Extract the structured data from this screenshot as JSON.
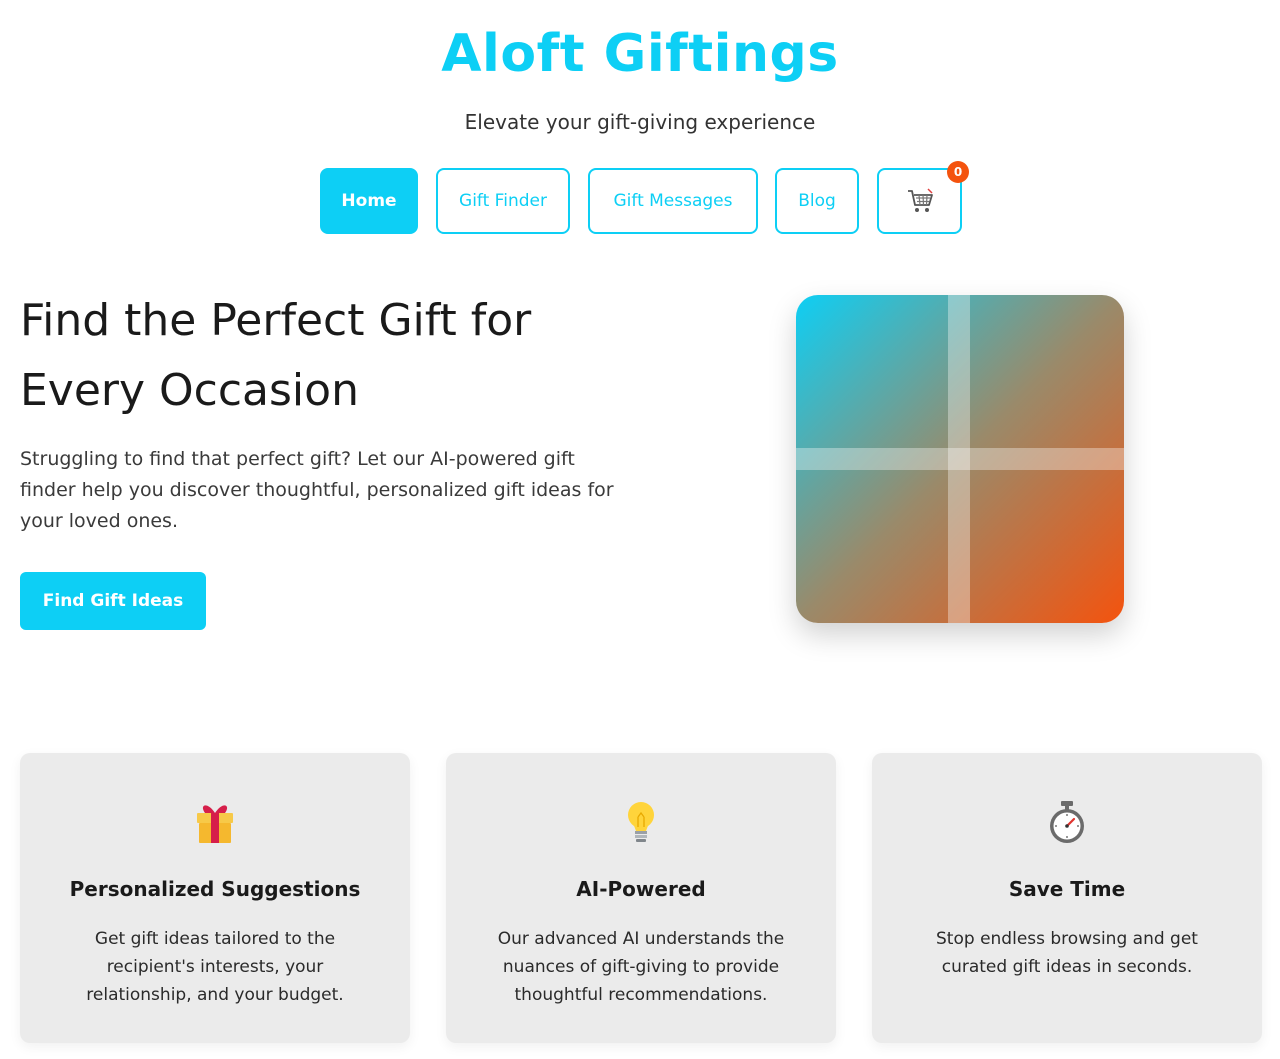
{
  "header": {
    "brand": "Aloft Giftings",
    "tagline": "Elevate your gift-giving experience"
  },
  "nav": {
    "items": [
      {
        "label": "Home",
        "active": true
      },
      {
        "label": "Gift Finder",
        "active": false
      },
      {
        "label": "Gift Messages",
        "active": false
      },
      {
        "label": "Blog",
        "active": false
      }
    ],
    "cart": {
      "icon": "cart-icon",
      "count": "0"
    }
  },
  "hero": {
    "title_line1": "Find the Perfect Gift for",
    "title_line2": "Every Occasion",
    "description": "Struggling to find that perfect gift? Let our AI-powered gift finder help you discover thoughtful, personalized gift ideas for your loved ones.",
    "cta": "Find Gift Ideas",
    "art_colors": [
      "#0dcff5",
      "#f4530e"
    ]
  },
  "features": [
    {
      "icon": "gift-icon",
      "title": "Personalized Suggestions",
      "text": "Get gift ideas tailored to the recipient's interests, your relationship, and your budget."
    },
    {
      "icon": "lightbulb-icon",
      "title": "AI-Powered",
      "text": "Our advanced AI understands the nuances of gift-giving to provide thoughtful recommendations."
    },
    {
      "icon": "stopwatch-icon",
      "title": "Save Time",
      "text": "Stop endless browsing and get curated gift ideas in seconds."
    }
  ],
  "colors": {
    "accent": "#0dcff5",
    "badge": "#f4530e",
    "card_bg": "#ebebeb"
  }
}
